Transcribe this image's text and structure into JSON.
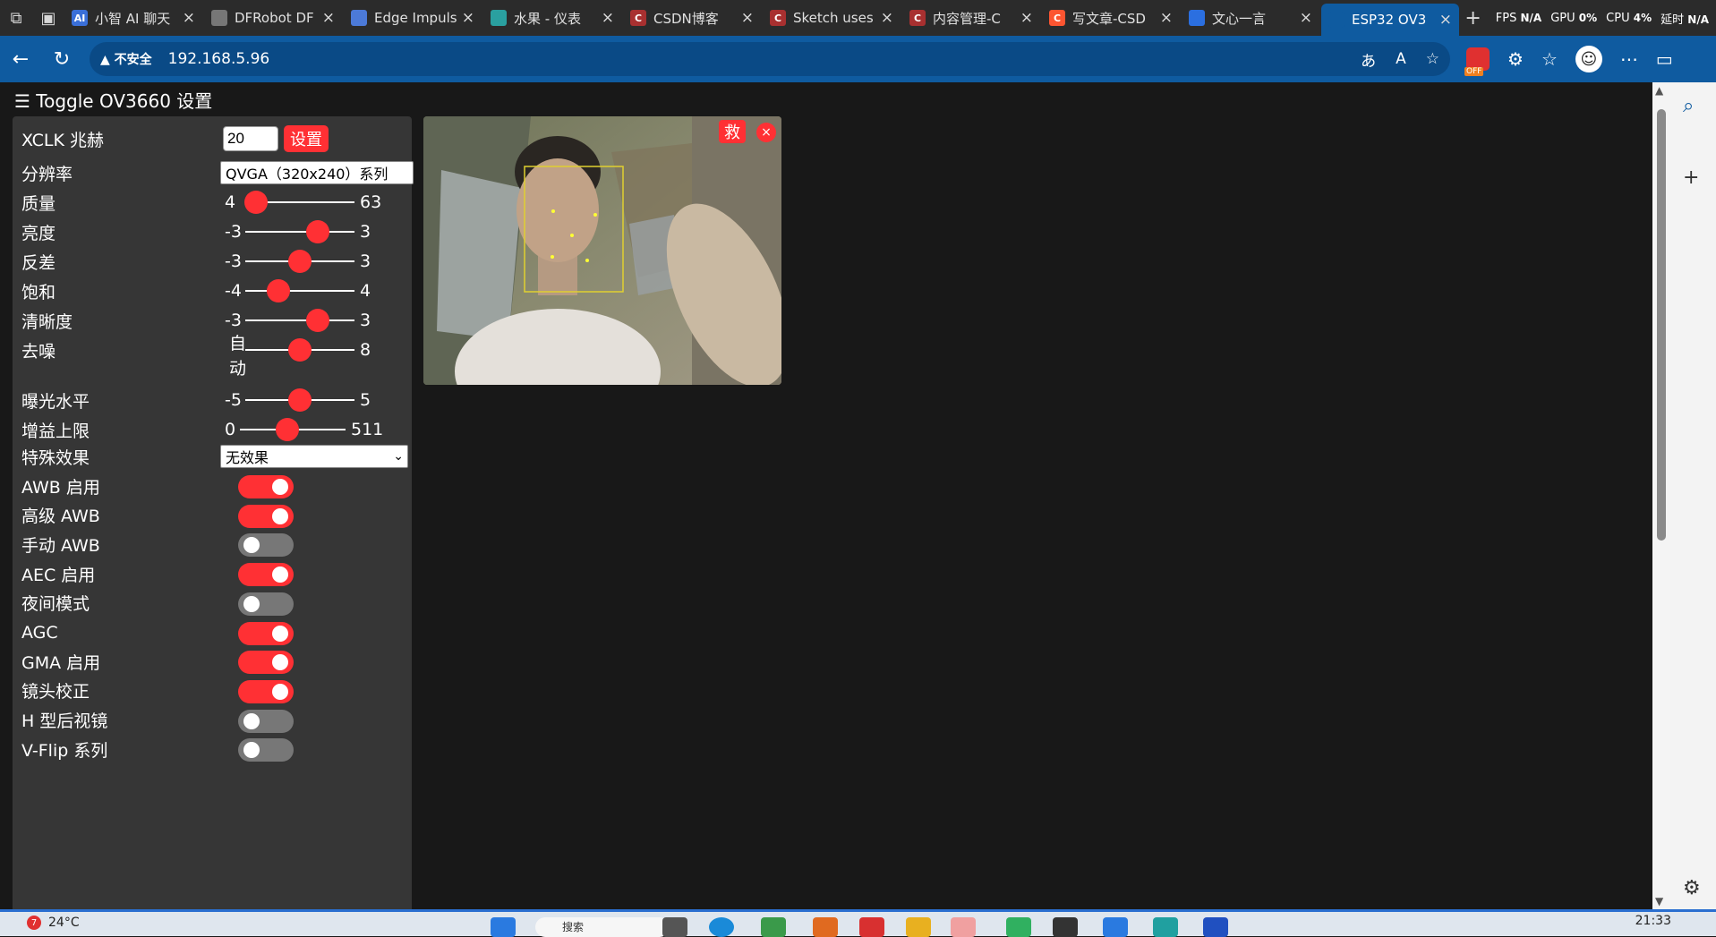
{
  "browser": {
    "tabs": [
      {
        "title": "小智 AI 聊天",
        "favicon_color": "#3a6fd8",
        "favicon_text": "AI",
        "active": false
      },
      {
        "title": "DFRobot DF",
        "favicon_color": "#777777",
        "favicon_text": "",
        "active": false
      },
      {
        "title": "Edge Impulse",
        "favicon_color": "#4c7ad8",
        "favicon_text": "",
        "active": false
      },
      {
        "title": "水果 - 仪表",
        "favicon_color": "#2aa0a0",
        "favicon_text": "",
        "active": false
      },
      {
        "title": "CSDN博客",
        "favicon_color": "#a83030",
        "favicon_text": "C",
        "active": false
      },
      {
        "title": "Sketch uses",
        "favicon_color": "#a83030",
        "favicon_text": "C",
        "active": false
      },
      {
        "title": "内容管理-C",
        "favicon_color": "#a83030",
        "favicon_text": "C",
        "active": false
      },
      {
        "title": "写文章-CSD",
        "favicon_color": "#fc5531",
        "favicon_text": "C",
        "active": false
      },
      {
        "title": "文心一言",
        "favicon_color": "#2b6fe0",
        "favicon_text": "",
        "active": false
      },
      {
        "title": "ESP32 OV3",
        "favicon_color": "#0f5ba0",
        "favicon_text": "",
        "active": true
      }
    ],
    "stats": {
      "fps_label": "FPS",
      "fps_value": "N/A",
      "gpu_label": "GPU",
      "gpu_value": "0%",
      "cpu_label": "CPU",
      "cpu_value": "4%",
      "latency_label": "延时",
      "latency_value": "N/A"
    },
    "address": {
      "security_label": "不安全",
      "url": "192.168.5.96",
      "off_badge": "OFF"
    }
  },
  "page": {
    "title": "☰ Toggle OV3660 设置",
    "xclk": {
      "label": "XCLK 兆赫",
      "value": "20",
      "button": "设置"
    },
    "resolution": {
      "label": "分辨率",
      "selected": "QVGA（320x240）系列"
    },
    "sliders": [
      {
        "label": "质量",
        "min": "4",
        "max": "63",
        "fraction": 0.1
      },
      {
        "label": "亮度",
        "min": "-3",
        "max": "3",
        "fraction": 0.667
      },
      {
        "label": "反差",
        "min": "-3",
        "max": "3",
        "fraction": 0.5
      },
      {
        "label": "饱和",
        "min": "-4",
        "max": "4",
        "fraction": 0.3
      },
      {
        "label": "清晰度",
        "min": "-3",
        "max": "3",
        "fraction": 0.667
      },
      {
        "label": "去噪",
        "min": "自动",
        "max": "8",
        "fraction": 0.5
      },
      {
        "label": "曝光水平",
        "min": "-5",
        "max": "5",
        "fraction": 0.5
      },
      {
        "label": "增益上限",
        "min": "0",
        "max": "511",
        "fraction": 0.45
      }
    ],
    "effect": {
      "label": "特殊效果",
      "selected": "无效果"
    },
    "toggles": [
      {
        "label": "AWB 启用",
        "on": true
      },
      {
        "label": "高级 AWB",
        "on": true
      },
      {
        "label": "手动 AWB",
        "on": false
      },
      {
        "label": "AEC 启用",
        "on": true
      },
      {
        "label": "夜间模式",
        "on": false
      },
      {
        "label": "AGC",
        "on": true
      },
      {
        "label": "GMA 启用",
        "on": true
      },
      {
        "label": "镜头校正",
        "on": true
      },
      {
        "label": "H 型后视镜",
        "on": false
      },
      {
        "label": "V-Flip 系列",
        "on": false
      }
    ],
    "stream": {
      "save_label": "救",
      "close_label": "×"
    },
    "accent": "#ff3034"
  },
  "taskbar": {
    "weather": "24°C",
    "weather_badge": "7",
    "search": "搜索",
    "time": "21:33"
  }
}
